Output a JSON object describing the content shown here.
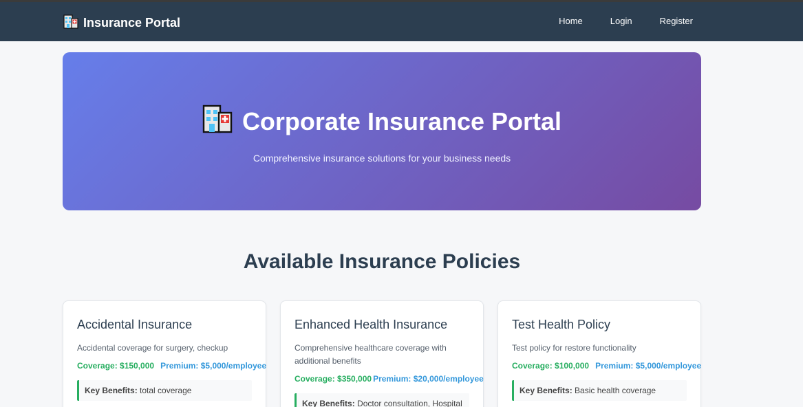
{
  "header": {
    "brand": "Insurance Portal",
    "brand_icon": "hospital-icon",
    "nav": [
      {
        "label": "Home"
      },
      {
        "label": "Login"
      },
      {
        "label": "Register"
      }
    ]
  },
  "hero": {
    "title": "Corporate Insurance Portal",
    "subtitle": "Comprehensive insurance solutions for your business needs",
    "icon": "hospital-icon"
  },
  "policies_section": {
    "title": "Available Insurance Policies",
    "policies": [
      {
        "name": "Accidental Insurance",
        "description": "Accidental coverage for surgery, checkup",
        "coverage": "Coverage: $150,000",
        "premium": "Premium: $5,000/employee",
        "benefits_label": "Key Benefits:",
        "benefits": "total coverage"
      },
      {
        "name": "Enhanced Health Insurance",
        "description": "Comprehensive healthcare coverage with additional benefits",
        "coverage": "Coverage: $350,000",
        "premium": "Premium: $20,000/employee",
        "benefits_label": "Key Benefits:",
        "benefits": "Doctor consultation, Hospital"
      },
      {
        "name": "Test Health Policy",
        "description": "Test policy for restore functionality",
        "coverage": "Coverage: $100,000",
        "premium": "Premium: $5,000/employee",
        "benefits_label": "Key Benefits:",
        "benefits": "Basic health coverage"
      }
    ]
  },
  "colors": {
    "navbar": "#2c3e50",
    "hero_gradient_start": "#667eea",
    "hero_gradient_end": "#764ba2",
    "coverage": "#27ae60",
    "premium": "#3498db"
  }
}
